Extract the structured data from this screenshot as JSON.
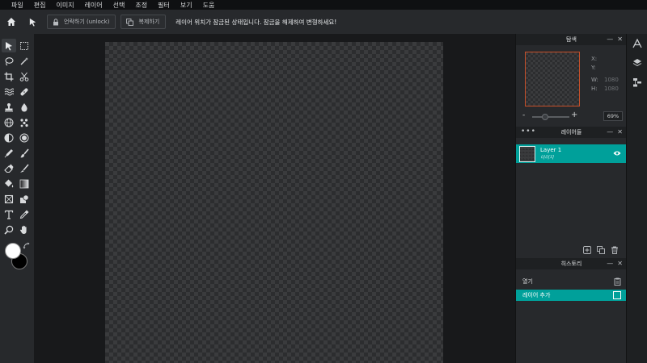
{
  "menubar": {
    "items": [
      "파일",
      "편집",
      "이미지",
      "레이어",
      "선택",
      "조정",
      "필터",
      "보기",
      "도움"
    ]
  },
  "toolbar": {
    "home_icon": "home-icon",
    "move_icon": "move-arrow-icon",
    "unlock_label": "언락하기 (unlock)",
    "duplicate_label": "복제하기",
    "message": "레이어 위치가 잠금된 상태입니다. 잠금을 해제하여 변형하세요!"
  },
  "colors": {
    "foreground": "#ffffff",
    "background": "#000000",
    "accent": "#00a09a",
    "nav_frame": "#c8502a"
  },
  "navigator": {
    "title": "탐색",
    "x_label": "X:",
    "y_label": "Y:",
    "w_label": "W:",
    "w_value": "1080",
    "h_label": "H:",
    "h_value": "1080",
    "zoom_minus": "-",
    "zoom_plus": "+",
    "zoom_value": "69%",
    "zoom_level": 0.35
  },
  "layers": {
    "title": "레이어들",
    "dots": "•••",
    "items": [
      {
        "name": "Layer 1",
        "subtitle": "이미지"
      }
    ]
  },
  "history": {
    "title": "히스토리",
    "items": [
      {
        "label": "열기"
      },
      {
        "label": "레이어 추가"
      }
    ]
  },
  "panel_controls": {
    "minimize": "—",
    "close": "✕"
  }
}
